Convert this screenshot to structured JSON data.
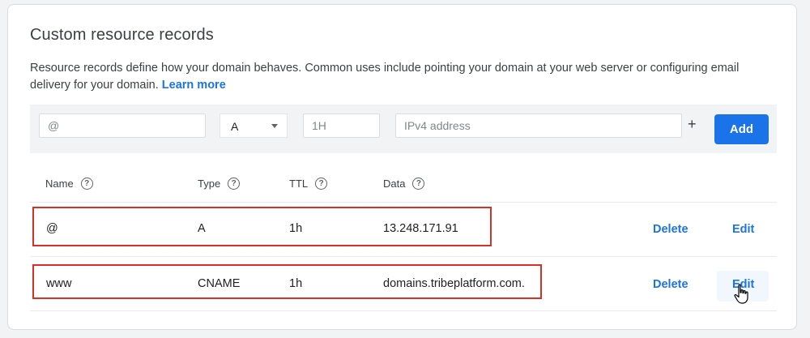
{
  "section": {
    "title": "Custom resource records",
    "description": "Resource records define how your domain behaves. Common uses include pointing your domain at your web server or configuring email delivery for your domain.",
    "learn_more": "Learn more"
  },
  "form": {
    "name_value": "",
    "name_placeholder": "@",
    "type_value": "A",
    "ttl_value": "",
    "ttl_placeholder": "1H",
    "data_value": "",
    "data_placeholder": "IPv4 address",
    "plus_label": "+",
    "add_label": "Add"
  },
  "table": {
    "headers": [
      "Name",
      "Type",
      "TTL",
      "Data"
    ],
    "help_glyph": "?",
    "rows": [
      {
        "name": "@",
        "type": "A",
        "ttl": "1h",
        "data": "13.248.171.91",
        "delete": "Delete",
        "edit": "Edit"
      },
      {
        "name": "www",
        "type": "CNAME",
        "ttl": "1h",
        "data": "domains.tribeplatform.com.",
        "delete": "Delete",
        "edit": "Edit"
      }
    ]
  },
  "colors": {
    "accent": "#1a73e8",
    "highlight_box": "#d93025",
    "toolbar_bg": "#f1f3f4"
  },
  "icons": {
    "help": "help-circle-icon",
    "caret": "caret-down-icon",
    "cursor": "hand-pointer-icon"
  }
}
